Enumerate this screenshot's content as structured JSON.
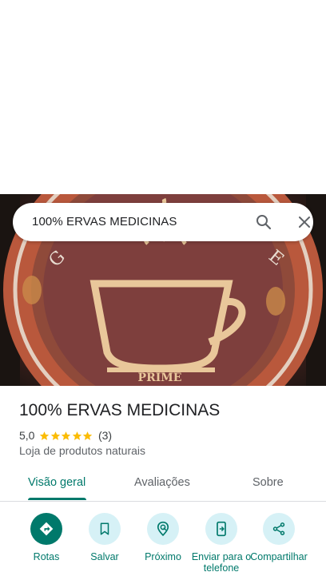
{
  "search": {
    "query": "100% ERVAS MEDICINAS"
  },
  "photo": {
    "cup_text": "PRIME"
  },
  "place": {
    "title": "100% ERVAS MEDICINAS",
    "rating": "5,0",
    "stars": 5,
    "review_count": "(3)",
    "category": "Loja de produtos naturais"
  },
  "tabs": [
    {
      "label": "Visão geral",
      "active": true
    },
    {
      "label": "Avaliações",
      "active": false
    },
    {
      "label": "Sobre",
      "active": false
    }
  ],
  "actions": [
    {
      "label": "Rotas",
      "icon": "directions-icon"
    },
    {
      "label": "Salvar",
      "icon": "bookmark-icon"
    },
    {
      "label": "Próximo",
      "icon": "nearby-icon"
    },
    {
      "label": "Enviar para o telefone",
      "icon": "send-to-phone-icon"
    },
    {
      "label": "Compartilhar",
      "icon": "share-icon"
    }
  ],
  "colors": {
    "accent": "#00796b",
    "action_bg": "#d6f1f6",
    "star": "#fbbc04"
  }
}
